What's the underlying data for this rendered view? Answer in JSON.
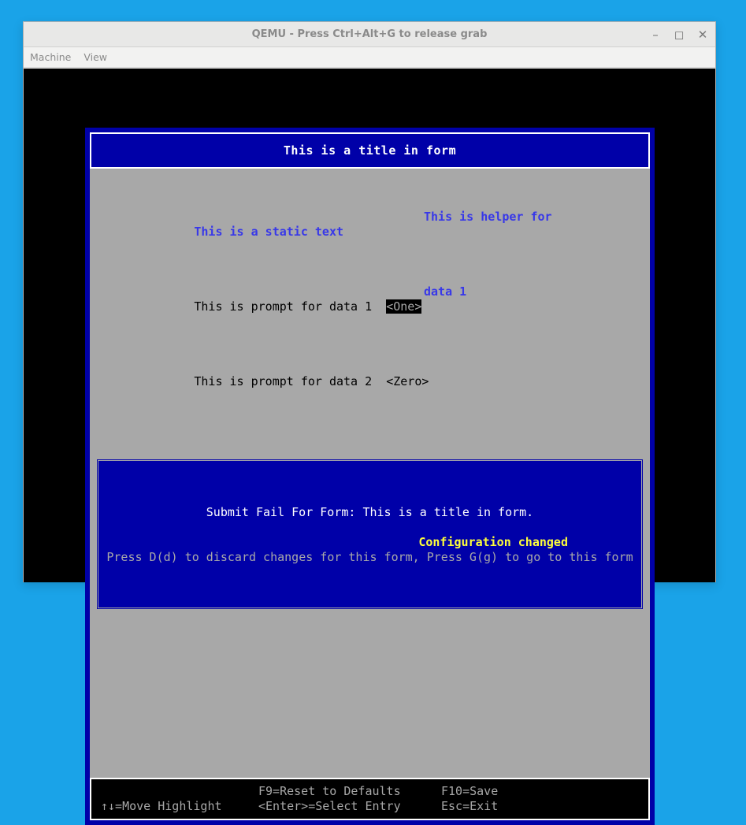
{
  "window": {
    "title": "QEMU - Press Ctrl+Alt+G to release grab"
  },
  "menubar": {
    "items": [
      "Machine",
      "View"
    ]
  },
  "form": {
    "title": "This is a title in form",
    "static_text": "This is a static text",
    "helper_label": "This is helper for",
    "helper_target": "data 1",
    "prompts": [
      {
        "label": "This is prompt for data 1",
        "value": "<One>",
        "selected": true
      },
      {
        "label": "This is prompt for data 2",
        "value": "<Zero>",
        "selected": false
      }
    ]
  },
  "dialog": {
    "line1": "Submit Fail For Form: This is a title in form.",
    "line2": "Press D(d) to discard changes for this form, Press G(g) to go to this form"
  },
  "footer": {
    "r1c2": "F9=Reset to Defaults",
    "r1c3": "F10=Save",
    "r2c1": "↑↓=Move Highlight",
    "r2c2": "<Enter>=Select Entry",
    "r2c3": "Esc=Exit"
  },
  "status": "Configuration changed"
}
